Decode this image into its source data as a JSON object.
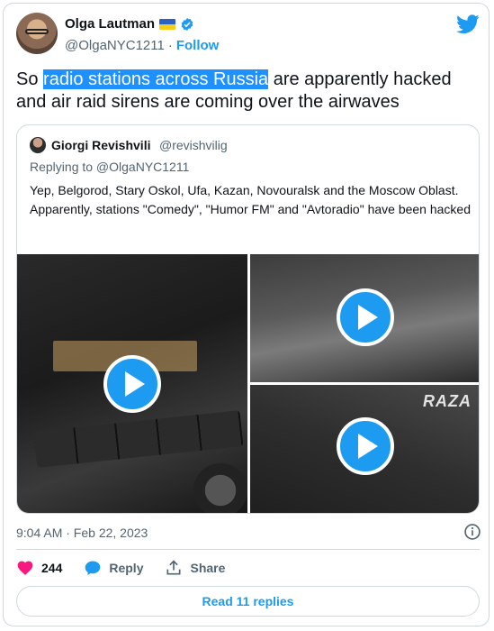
{
  "author": {
    "name": "Olga Lautman",
    "flag_icon": "ukraine-flag-icon",
    "verified_icon": "verified-badge-icon",
    "handle": "@OlgaNYC1211",
    "separator": "·",
    "follow_label": "Follow"
  },
  "tweet": {
    "text_before": "So ",
    "text_highlight": "radio stations across Russia",
    "text_after": " are apparently hacked and air raid sirens are coming over the airwaves",
    "timestamp": "9:04 AM · Feb 22, 2023"
  },
  "quote": {
    "name": "Giorgi Revishvili",
    "handle": "@revishvilig",
    "replying_to": "Replying to @OlgaNYC1211",
    "text": "Yep, Belgorod, Stary Oskol, Ufa, Kazan, Novouralsk and the Moscow Oblast. Apparently, stations \"Comedy\", \"Humor FM\" and \"Avtoradio\" have been hacked",
    "media_watermark": "RAZA"
  },
  "actions": {
    "like_count": "244",
    "reply_label": "Reply",
    "share_label": "Share"
  },
  "read_replies_label": "Read 11 replies",
  "colors": {
    "accent": "#1d9bf0",
    "highlight": "#1e90ff",
    "like": "#f91880",
    "muted": "#536471",
    "border": "#cfd9de"
  }
}
